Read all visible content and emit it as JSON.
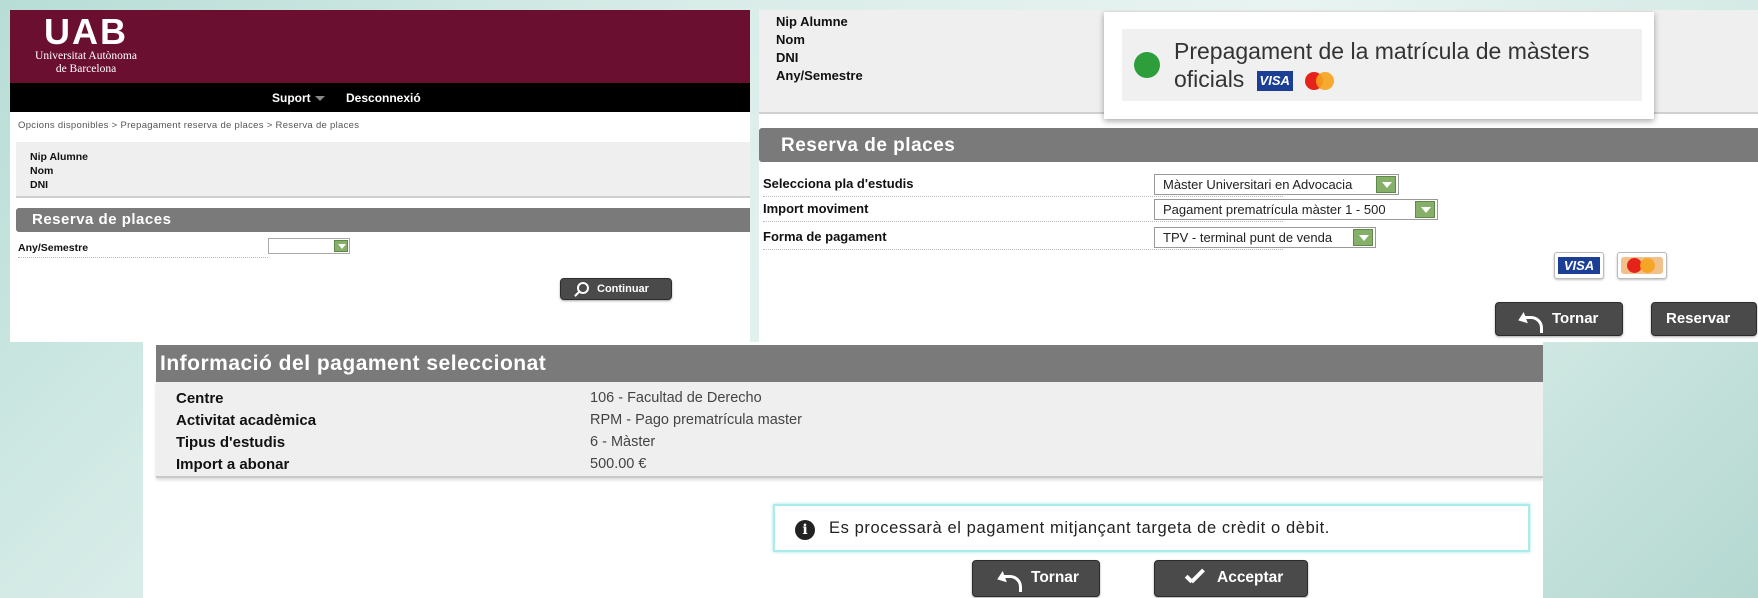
{
  "panel1": {
    "logo": {
      "mark": "UAB",
      "line1": "Universitat Autònoma",
      "line2": "de Barcelona"
    },
    "nav": {
      "suport": "Suport",
      "logout": "Desconnexió"
    },
    "breadcrumb": "Opcions disponibles > Prepagament reserva de places > Reserva de places",
    "info_labels": [
      "Nip Alumne",
      "Nom",
      "DNI"
    ],
    "section_title": "Reserva de places",
    "field_label": "Any/Semestre",
    "field_value": "",
    "continue_label": "Continuar"
  },
  "panel2": {
    "info_labels": [
      "Nip Alumne",
      "Nom",
      "DNI",
      "Any/Semestre"
    ],
    "promo_text": "Prepagament de la matrícula de màsters oficials",
    "promo_visa": "VISA",
    "section_title": "Reserva de places",
    "fields": [
      {
        "label": "Selecciona pla d'estudis",
        "value": "Màster Universitari en Advocacia"
      },
      {
        "label": "Import moviment",
        "value": "Pagament prematrícula màster 1 - 500"
      },
      {
        "label": "Forma de pagament",
        "value": "TPV - terminal punt de venda"
      }
    ],
    "visa_label": "VISA",
    "back_label": "Tornar",
    "reserve_label": "Reservar"
  },
  "panel3": {
    "section_title": "Informació del pagament seleccionat",
    "rows": [
      {
        "key": "Centre",
        "value": "106 - Facultad de Derecho"
      },
      {
        "key": "Activitat acadèmica",
        "value": "RPM - Pago prematrícula master"
      },
      {
        "key": "Tipus d'estudis",
        "value": "6 - Màster"
      },
      {
        "key": "Import a abonar",
        "value": "500.00 €"
      }
    ],
    "notice": "Es processarà el pagament mitjançant targeta de crèdit o dèbit.",
    "back_label": "Tornar",
    "accept_label": "Acceptar"
  },
  "colors": {
    "brand": "#6b0f30",
    "section_bar": "#7a7a7a",
    "button": "#4a4a4a",
    "select_arrow": "#86b06a",
    "status_dot": "#2e9e3a"
  }
}
